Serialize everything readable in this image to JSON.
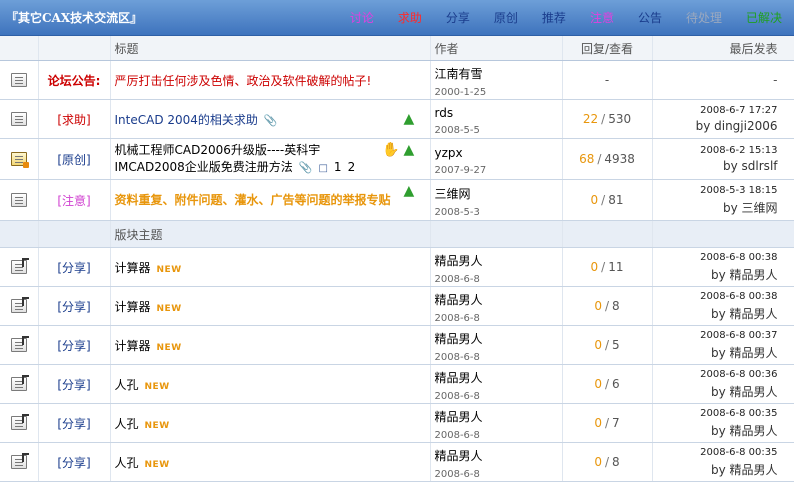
{
  "board": {
    "title": "『其它CAX技术交流区』"
  },
  "filters": [
    {
      "label": "讨论",
      "color": "#e040e0"
    },
    {
      "label": "求助",
      "color": "#ff2a2a"
    },
    {
      "label": "分享",
      "color": "#1a3c8c"
    },
    {
      "label": "原创",
      "color": "#1a3c8c"
    },
    {
      "label": "推荐",
      "color": "#1a3c8c"
    },
    {
      "label": "注意",
      "color": "#e040e0"
    },
    {
      "label": "公告",
      "color": "#1a3c8c"
    },
    {
      "label": "待处理",
      "color": "#9aa8bf"
    },
    {
      "label": "已解决",
      "color": "#1fa01f"
    }
  ],
  "columns": {
    "title": "标题",
    "author": "作者",
    "replies": "回复/查看",
    "last": "最后发表"
  },
  "announcement": {
    "label": "论坛公告:",
    "title": "严厉打击任何涉及色情、政治及软件破解的帖子!",
    "author": "江南有雪",
    "date": "2000-1-25",
    "replies": "-",
    "last": "-"
  },
  "pinned": [
    {
      "cat": "[求助]",
      "cat_color": "#cc0000",
      "title": "InteCAD 2004的相关求助",
      "author": "rds",
      "date": "2008-5-5",
      "replies": "22",
      "views": "530",
      "last_time": "2008-6-7 17:27",
      "last_by": "by dingji2006"
    },
    {
      "cat": "[原创]",
      "cat_color": "#1a3c8c",
      "title": "机械工程师CAD2006升级版----英科宇IMCAD2008企业版免费注册方法",
      "pages": [
        "1",
        "2"
      ],
      "author": "yzpx",
      "date": "2007-9-27",
      "replies": "68",
      "views": "4938",
      "last_time": "2008-6-2 15:13",
      "last_by": "by sdlrslf"
    },
    {
      "cat": "[注意]",
      "cat_color": "#d040d0",
      "title": "资料重复、附件问题、灌水、广告等问题的举报专贴",
      "author": "三维网",
      "date": "2008-5-3",
      "replies": "0",
      "views": "81",
      "last_time": "2008-5-3 18:15",
      "last_by": "by 三维网"
    }
  ],
  "section_label": "版块主题",
  "new_badge": "NEW",
  "threads": [
    {
      "cat": "[分享]",
      "title": "计算器",
      "author": "精品男人",
      "date": "2008-6-8",
      "replies": "0",
      "views": "11",
      "last_time": "2008-6-8 00:38",
      "last_by": "by 精品男人"
    },
    {
      "cat": "[分享]",
      "title": "计算器",
      "author": "精品男人",
      "date": "2008-6-8",
      "replies": "0",
      "views": "8",
      "last_time": "2008-6-8 00:38",
      "last_by": "by 精品男人"
    },
    {
      "cat": "[分享]",
      "title": "计算器",
      "author": "精品男人",
      "date": "2008-6-8",
      "replies": "0",
      "views": "5",
      "last_time": "2008-6-8 00:37",
      "last_by": "by 精品男人"
    },
    {
      "cat": "[分享]",
      "title": "人孔",
      "author": "精品男人",
      "date": "2008-6-8",
      "replies": "0",
      "views": "6",
      "last_time": "2008-6-8 00:36",
      "last_by": "by 精品男人"
    },
    {
      "cat": "[分享]",
      "title": "人孔",
      "author": "精品男人",
      "date": "2008-6-8",
      "replies": "0",
      "views": "7",
      "last_time": "2008-6-8 00:35",
      "last_by": "by 精品男人"
    },
    {
      "cat": "[分享]",
      "title": "人孔",
      "author": "精品男人",
      "date": "2008-6-8",
      "replies": "0",
      "views": "8",
      "last_time": "2008-6-8 00:35",
      "last_by": "by 精品男人"
    }
  ]
}
